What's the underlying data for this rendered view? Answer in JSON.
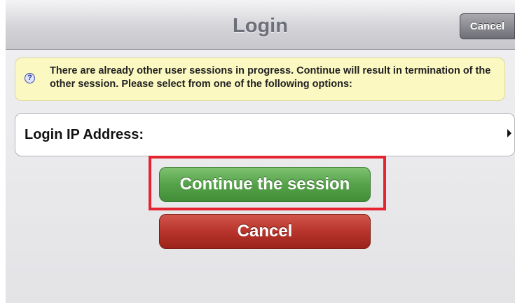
{
  "navbar": {
    "title": "Login",
    "cancel_label": "Cancel"
  },
  "warning": {
    "icon": "question-icon",
    "text": "There are already other user sessions in progress. Continue will result in termination of the other session. Please select from one of the following options:"
  },
  "ip_row": {
    "label": "Login IP Address:",
    "icon": "chevron-right-icon"
  },
  "buttons": {
    "continue_label": "Continue the session",
    "cancel_label": "Cancel"
  },
  "colors": {
    "continue": "#56a24a",
    "cancel": "#b7342b",
    "highlight": "#e42431",
    "warning_bg": "#fbf8c2"
  }
}
